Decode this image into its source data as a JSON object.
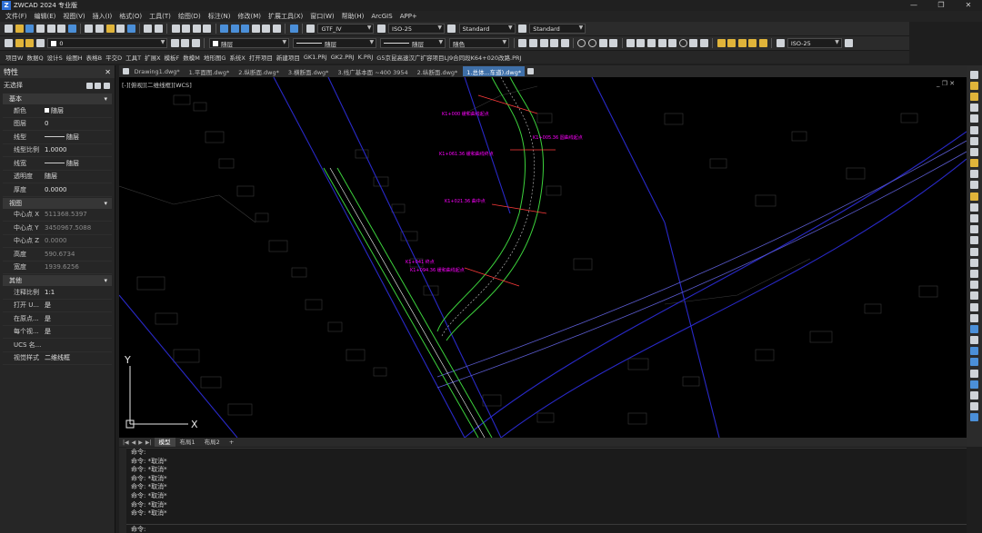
{
  "app": {
    "title": "ZWCAD 2024 专业版",
    "logo": "Z"
  },
  "window_controls": [
    "—",
    "❐",
    "✕"
  ],
  "menu": [
    "文件(F)",
    "编辑(E)",
    "视图(V)",
    "插入(I)",
    "格式(O)",
    "工具(T)",
    "绘图(D)",
    "标注(N)",
    "修改(M)",
    "扩展工具(X)",
    "窗口(W)",
    "帮助(H)",
    "ArcGIS",
    "APP+"
  ],
  "toolbar1": {
    "textstyle": "GTF_IV",
    "dimstyle": "ISO-25",
    "tablestyle": "Standard",
    "mleaderstyle": "Standard"
  },
  "toolbar2": {
    "layer": "0",
    "color": "随层",
    "linetype": "随层",
    "lineweight": "随层",
    "plotstyle": "随色",
    "dimstyle": "ISO-25"
  },
  "project_bar": [
    "项目W",
    "数据Q",
    "设计S",
    "绘图H",
    "表格B",
    "平交D",
    "工具T",
    "扩展X",
    "模板F",
    "数模M",
    "地形图G",
    "系统X",
    "打开项目",
    "新建项目",
    "GK1.PRJ",
    "GK2.PRJ",
    "K.PRJ",
    "G5京昆高速汉广扩容项目LJ9合同段K64+020改路.PRJ"
  ],
  "properties": {
    "title": "特性",
    "selection": "无选择",
    "sections": [
      {
        "name": "基本",
        "rows": [
          {
            "k": "颜色",
            "v": "随层",
            "swatch": true
          },
          {
            "k": "图层",
            "v": "0"
          },
          {
            "k": "线型",
            "v": "随层",
            "line": true
          },
          {
            "k": "线型比例",
            "v": "1.0000"
          },
          {
            "k": "线宽",
            "v": "随层",
            "line": true
          },
          {
            "k": "透明度",
            "v": "随层"
          },
          {
            "k": "厚度",
            "v": "0.0000"
          }
        ]
      },
      {
        "name": "视图",
        "rows": [
          {
            "k": "中心点 X",
            "v": "511368.5397",
            "dim": true
          },
          {
            "k": "中心点 Y",
            "v": "3450967.5088",
            "dim": true
          },
          {
            "k": "中心点 Z",
            "v": "0.0000",
            "dim": true
          },
          {
            "k": "高度",
            "v": "590.6734",
            "dim": true
          },
          {
            "k": "宽度",
            "v": "1939.6256",
            "dim": true
          }
        ]
      },
      {
        "name": "其他",
        "rows": [
          {
            "k": "注释比例",
            "v": "1:1"
          },
          {
            "k": "打开 U...",
            "v": "是"
          },
          {
            "k": "在原点...",
            "v": "是"
          },
          {
            "k": "每个视...",
            "v": "是"
          },
          {
            "k": "UCS 名...",
            "v": ""
          },
          {
            "k": "视觉样式",
            "v": "二维线框"
          }
        ]
      }
    ]
  },
  "doc_tabs": [
    {
      "label": "Drawing1.dwg*",
      "active": false
    },
    {
      "label": "1.平面图.dwg*",
      "active": false
    },
    {
      "label": "2.纵断面.dwg*",
      "active": false
    },
    {
      "label": "3.横断面.dwg*",
      "active": false
    },
    {
      "label": "3.线广基本面 ~400 3954",
      "active": false
    },
    {
      "label": "2.纵断面.dwg*",
      "active": false
    },
    {
      "label": "1.总体...车道).dwg*",
      "active": true
    }
  ],
  "viewport_label": "[-][俯视][二维线框][WCS]",
  "viewport_controls": "_ ❐ ✕",
  "ucs": {
    "x": "X",
    "y": "Y"
  },
  "drawing_labels": [
    "K1+000 缓和曲线起点",
    "K1+005.36 圆曲线起点",
    "K1+061.36 缓和曲线终点",
    "K1+021.36 曲中点",
    "K1+041 终点",
    "K1+094.36 缓和曲线起点"
  ],
  "layout_tabs": [
    {
      "label": "模型",
      "active": true
    },
    {
      "label": "布局1",
      "active": false
    },
    {
      "label": "布局2",
      "active": false
    },
    {
      "label": "+",
      "active": false
    }
  ],
  "command_lines": [
    "命令:",
    "命令: *取消*",
    "命令: *取消*",
    "命令: *取消*",
    "命令: *取消*",
    "命令: *取消*",
    "命令: *取消*",
    "命令: *取消*"
  ],
  "command_prompt": "命令:",
  "colors": {
    "accent": "#3e6fa8",
    "road_green": "#3cd23c",
    "magenta": "#ff00ff",
    "blue_line": "#2929c8"
  }
}
